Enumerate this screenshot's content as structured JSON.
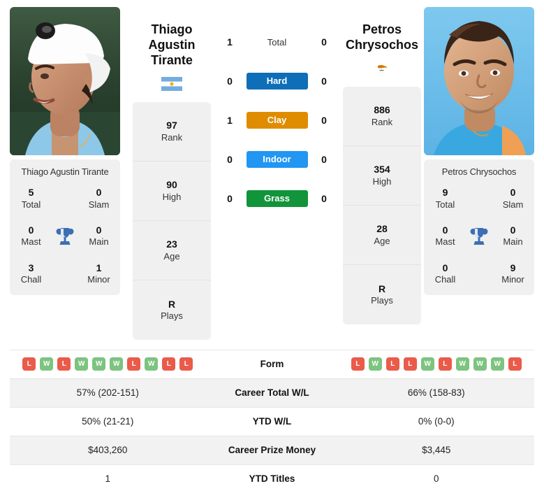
{
  "colors": {
    "win": "#7cc47f",
    "loss": "#ea5b4a",
    "hard": "#0e6eb8",
    "clay": "#e08c00",
    "indoor": "#2196f3",
    "grass": "#12943b",
    "trophy": "#3c6eb4"
  },
  "players": {
    "left": {
      "full_name": "Thiago Agustin Tirante",
      "display_name_line1": "Thiago Agustin",
      "display_name_line2": "Tirante",
      "country": "Argentina",
      "flag_icon": "flag-argentina-icon",
      "photo_alt": "Thiago Agustin Tirante headshot",
      "titles": {
        "total": "5",
        "total_label": "Total",
        "slam": "0",
        "slam_label": "Slam",
        "mast": "0",
        "mast_label": "Mast",
        "main": "0",
        "main_label": "Main",
        "chall": "3",
        "chall_label": "Chall",
        "minor": "1",
        "minor_label": "Minor"
      },
      "info": [
        {
          "value": "97",
          "label": "Rank"
        },
        {
          "value": "90",
          "label": "High"
        },
        {
          "value": "23",
          "label": "Age"
        },
        {
          "value": "R",
          "label": "Plays"
        }
      ],
      "surface_counts": {
        "total": "1",
        "hard": "0",
        "clay": "1",
        "indoor": "0",
        "grass": "0"
      },
      "form": [
        "L",
        "W",
        "L",
        "W",
        "W",
        "W",
        "L",
        "W",
        "L",
        "L"
      ],
      "career_total_wl": "57% (202-151)",
      "ytd_wl": "50% (21-21)",
      "career_prize_money": "$403,260",
      "ytd_titles": "1"
    },
    "right": {
      "full_name": "Petros Chrysochos",
      "display_name_line1": "Petros",
      "display_name_line2": "Chrysochos",
      "country": "Cyprus",
      "flag_icon": "flag-cyprus-icon",
      "photo_alt": "Petros Chrysochos headshot",
      "titles": {
        "total": "9",
        "total_label": "Total",
        "slam": "0",
        "slam_label": "Slam",
        "mast": "0",
        "mast_label": "Mast",
        "main": "0",
        "main_label": "Main",
        "chall": "0",
        "chall_label": "Chall",
        "minor": "9",
        "minor_label": "Minor"
      },
      "info": [
        {
          "value": "886",
          "label": "Rank"
        },
        {
          "value": "354",
          "label": "High"
        },
        {
          "value": "28",
          "label": "Age"
        },
        {
          "value": "R",
          "label": "Plays"
        }
      ],
      "surface_counts": {
        "total": "0",
        "hard": "0",
        "clay": "0",
        "indoor": "0",
        "grass": "0"
      },
      "form": [
        "L",
        "W",
        "L",
        "L",
        "W",
        "L",
        "W",
        "W",
        "W",
        "L"
      ],
      "career_total_wl": "66% (158-83)",
      "ytd_wl": "0% (0-0)",
      "career_prize_money": "$3,445",
      "ytd_titles": "0"
    }
  },
  "surfaces": [
    {
      "key": "total",
      "label": "Total",
      "bar": false
    },
    {
      "key": "hard",
      "label": "Hard",
      "bar": true,
      "color": "#0e6eb8"
    },
    {
      "key": "clay",
      "label": "Clay",
      "bar": true,
      "color": "#e08c00"
    },
    {
      "key": "indoor",
      "label": "Indoor",
      "bar": true,
      "color": "#2196f3"
    },
    {
      "key": "grass",
      "label": "Grass",
      "bar": true,
      "color": "#12943b"
    }
  ],
  "table_labels": {
    "form": "Form",
    "career_total_wl": "Career Total W/L",
    "ytd_wl": "YTD W/L",
    "career_prize_money": "Career Prize Money",
    "ytd_titles": "YTD Titles"
  }
}
